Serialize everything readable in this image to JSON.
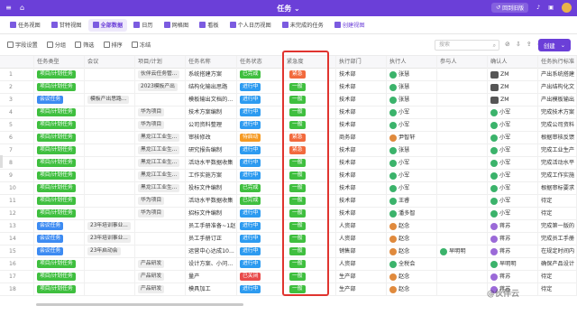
{
  "app": {
    "title": "任务",
    "back_label": "回到旧版"
  },
  "views": [
    {
      "label": "任务视图",
      "active": false
    },
    {
      "label": "甘特视图",
      "active": false
    },
    {
      "label": "全部数据",
      "active": true
    },
    {
      "label": "日历",
      "active": false
    },
    {
      "label": "网格图",
      "active": false
    },
    {
      "label": "看板",
      "active": false
    },
    {
      "label": "个人日历视图",
      "active": false
    },
    {
      "label": "未完成的任务",
      "active": false
    },
    {
      "label": "创建视图",
      "active": false
    }
  ],
  "toolbar": {
    "fields": "字段设置",
    "group": "分组",
    "filter": "筛选",
    "sort": "排序",
    "freeze": "冻结",
    "search_placeholder": "搜索",
    "create_label": "创建"
  },
  "columns": [
    "任务类型",
    "会议",
    "项目/计划",
    "任务名称",
    "任务状态",
    "紧急度",
    "执行部门",
    "执行人",
    "参与人",
    "确认人",
    "任务执行标准"
  ],
  "rows": [
    {
      "n": "1",
      "type": "项目/计划任务",
      "meeting": "",
      "project": "伙伴云任务管...",
      "name": "系统搭建方案",
      "status": "已完成",
      "urg": "紧急",
      "dept": "技术部",
      "exec": "张慧",
      "part": "",
      "conf": "ZM",
      "std": "产出系统搭建"
    },
    {
      "n": "2",
      "type": "项目/计划任务",
      "meeting": "",
      "project": "2023模板产出",
      "name": "结构化输出思路",
      "status": "进行中",
      "urg": "一般",
      "dept": "技术部",
      "exec": "张慧",
      "part": "",
      "conf": "ZM",
      "std": "产出结构化文"
    },
    {
      "n": "3",
      "type": "会议任务",
      "meeting": "模板产出思路...",
      "project": "",
      "name": "模板输出文档的...",
      "status": "进行中",
      "urg": "一般",
      "dept": "技术部",
      "exec": "张慧",
      "part": "",
      "conf": "ZM",
      "std": "产出模板输出"
    },
    {
      "n": "4",
      "type": "项目/计划任务",
      "meeting": "",
      "project": "华为项目",
      "name": "技术方案编制",
      "status": "进行中",
      "urg": "一般",
      "dept": "技术部",
      "exec": "小军",
      "part": "",
      "conf": "小军",
      "std": "完成技术方案"
    },
    {
      "n": "5",
      "type": "项目/计划任务",
      "meeting": "",
      "project": "华为项目",
      "name": "公司资料整理",
      "status": "进行中",
      "urg": "一般",
      "dept": "技术部",
      "exec": "小军",
      "part": "",
      "conf": "小军",
      "std": "完成公司资料"
    },
    {
      "n": "6",
      "type": "项目/计划任务",
      "meeting": "",
      "project": "黑龙江工业生...",
      "name": "审核修改",
      "status": "待启动",
      "urg": "紧急",
      "dept": "商务部",
      "exec": "尹智轩",
      "part": "",
      "conf": "小军",
      "std": "根据审核反馈"
    },
    {
      "n": "7",
      "type": "项目/计划任务",
      "meeting": "",
      "project": "黑龙江工业生...",
      "name": "研究报告编制",
      "status": "进行中",
      "urg": "紧急",
      "dept": "技术部",
      "exec": "张慧",
      "part": "",
      "conf": "小军",
      "std": "完成工业生产"
    },
    {
      "n": "8",
      "type": "项目/计划任务",
      "meeting": "",
      "project": "黑龙江工业生...",
      "name": "活动水平数据收集",
      "status": "进行中",
      "urg": "一般",
      "dept": "技术部",
      "exec": "小军",
      "part": "",
      "conf": "小军",
      "std": "完成活动水平"
    },
    {
      "n": "9",
      "type": "项目/计划任务",
      "meeting": "",
      "project": "黑龙江工业生...",
      "name": "工作实施方案",
      "status": "进行中",
      "urg": "一般",
      "dept": "技术部",
      "exec": "小军",
      "part": "",
      "conf": "小军",
      "std": "完成工作实施"
    },
    {
      "n": "10",
      "type": "项目/计划任务",
      "meeting": "",
      "project": "黑龙江工业生...",
      "name": "投标文件编制",
      "status": "已完成",
      "urg": "一般",
      "dept": "技术部",
      "exec": "小军",
      "part": "",
      "conf": "小军",
      "std": "根据审标要求"
    },
    {
      "n": "11",
      "type": "项目/计划任务",
      "meeting": "",
      "project": "华为项目",
      "name": "活动水平数据收集",
      "status": "已完成",
      "urg": "一般",
      "dept": "技术部",
      "exec": "王睿",
      "part": "",
      "conf": "小军",
      "std": "待定"
    },
    {
      "n": "12",
      "type": "项目/计划任务",
      "meeting": "",
      "project": "华为项目",
      "name": "招标文件编制",
      "status": "进行中",
      "urg": "一般",
      "dept": "技术部",
      "exec": "潘多智",
      "part": "",
      "conf": "小军",
      "std": "待定"
    },
    {
      "n": "13",
      "type": "会议任务",
      "meeting": "23年培训事业...",
      "project": "",
      "name": "员工手册准备~1赵",
      "status": "进行中",
      "urg": "一般",
      "dept": "人资部",
      "exec": "赵念",
      "part": "",
      "conf": "蒋苏",
      "std": "完成第一版的"
    },
    {
      "n": "14",
      "type": "会议任务",
      "meeting": "23年培训事业...",
      "project": "",
      "name": "员工手册订正",
      "status": "进行中",
      "urg": "一般",
      "dept": "人资部",
      "exec": "赵念",
      "part": "",
      "conf": "蒋苏",
      "std": "完成员工手册"
    },
    {
      "n": "15",
      "type": "会议任务",
      "meeting": "23年启动会",
      "project": "",
      "name": "运营中心达成10...",
      "status": "进行中",
      "urg": "一般",
      "dept": "销售部",
      "exec": "赵念",
      "part": "早明明",
      "conf": "蒋苏",
      "std": "在规定时间内"
    },
    {
      "n": "16",
      "type": "项目/计划任务",
      "meeting": "",
      "project": "产品研发",
      "name": "设计方案、小问...",
      "status": "进行中",
      "urg": "一般",
      "dept": "人资部",
      "exec": "全税会",
      "part": "",
      "conf": "早明明",
      "std": "确保产品设计"
    },
    {
      "n": "17",
      "type": "项目/计划任务",
      "meeting": "",
      "project": "产品研发",
      "name": "量产",
      "status": "已关闭",
      "urg": "一般",
      "dept": "生产部",
      "exec": "赵念",
      "part": "",
      "conf": "蒋苏",
      "std": "待定"
    },
    {
      "n": "18",
      "type": "项目/计划任务",
      "meeting": "",
      "project": "产品研发",
      "name": "模具加工",
      "status": "进行中",
      "urg": "一般",
      "dept": "生产部",
      "exec": "赵念",
      "part": "",
      "conf": "蒋苏",
      "std": "待定"
    }
  ],
  "watermark": "@伙伴云"
}
